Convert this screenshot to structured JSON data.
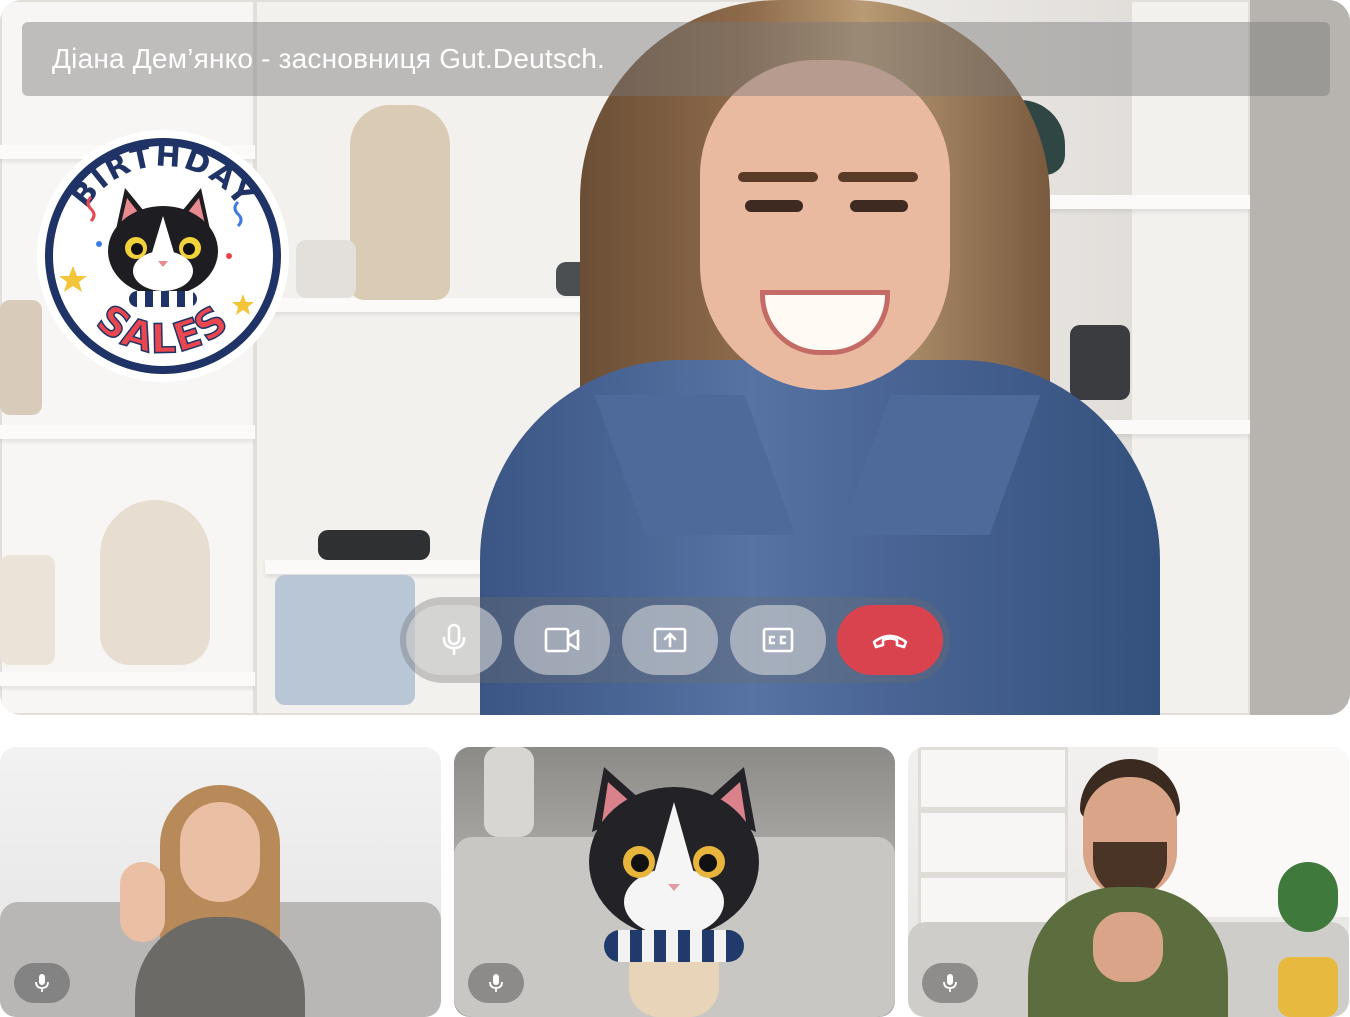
{
  "call": {
    "speaker_title": "Діана Дем’янко - засновниця Gut.Deutsch."
  },
  "badge": {
    "top_text": "BIRTHDAY",
    "bottom_text": "SALES"
  },
  "controls": {
    "mic_icon": "microphone-icon",
    "camera_icon": "video-camera-icon",
    "share_icon": "screen-share-icon",
    "captions_icon": "closed-captions-icon",
    "end_icon": "hang-up-phone-icon",
    "end_color": "#d9434e"
  },
  "participants": [
    {
      "mic_icon": "microphone-icon"
    },
    {
      "mic_icon": "microphone-icon"
    },
    {
      "mic_icon": "microphone-icon"
    }
  ],
  "colors": {
    "badge_ring": "#1f3366",
    "badge_text_top": "#1f3366",
    "badge_text_bottom": "#e8474f"
  }
}
